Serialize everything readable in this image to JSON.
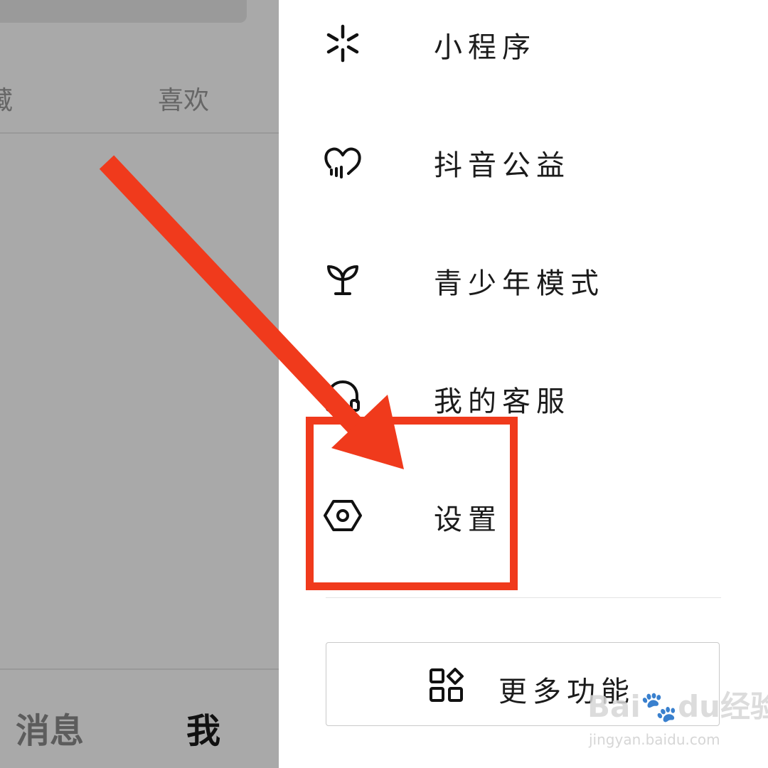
{
  "left_panel": {
    "top_card_text": "",
    "tabs": [
      {
        "label": "藏"
      },
      {
        "label": "喜欢"
      }
    ],
    "bottom_nav": [
      {
        "label": "消息"
      },
      {
        "label": "我"
      }
    ]
  },
  "drawer": {
    "menu_items": [
      {
        "label": "小程序",
        "icon": "mini-program-icon"
      },
      {
        "label": "抖音公益",
        "icon": "charity-heart-icon"
      },
      {
        "label": "青少年模式",
        "icon": "sprout-icon"
      },
      {
        "label": "我的客服",
        "icon": "headset-icon"
      },
      {
        "label": "设置",
        "icon": "hexagon-settings-icon"
      }
    ],
    "more_button": {
      "label": "更多功能",
      "icon": "apps-grid-icon"
    }
  },
  "annotation": {
    "color": "#f03a1c",
    "highlighted_item": "设置"
  },
  "watermark": {
    "logo": "Bai",
    "logo_suffix": "du",
    "logo_cn": "经验",
    "url": "jingyan.baidu.com"
  }
}
